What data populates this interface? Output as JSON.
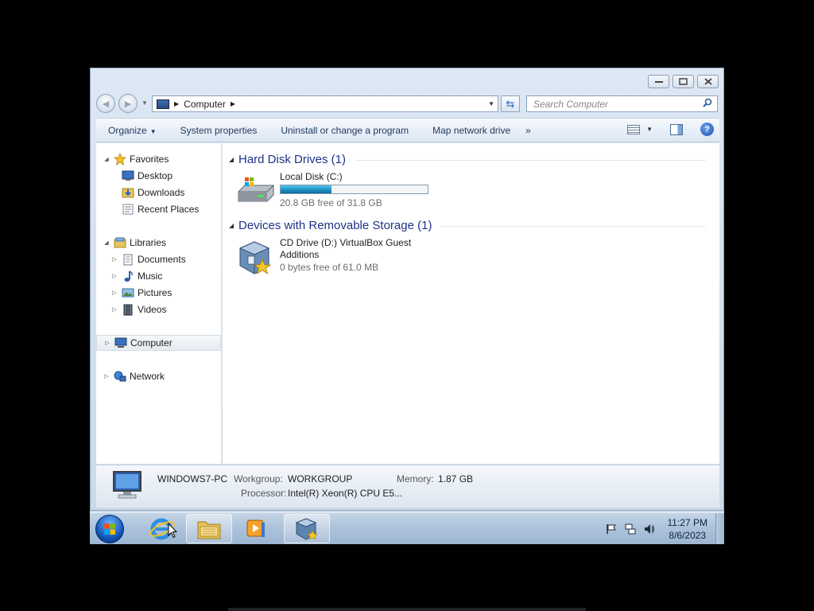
{
  "window": {
    "caption_buttons": [
      "minimize",
      "maximize",
      "close"
    ]
  },
  "address": {
    "crumb": "Computer",
    "search_placeholder": "Search Computer"
  },
  "toolbar": {
    "organize": "Organize",
    "system_properties": "System properties",
    "uninstall": "Uninstall or change a program",
    "map_drive": "Map network drive",
    "more": "»"
  },
  "nav": {
    "favorites": "Favorites",
    "desktop": "Desktop",
    "downloads": "Downloads",
    "recent": "Recent Places",
    "libraries": "Libraries",
    "documents": "Documents",
    "music": "Music",
    "pictures": "Pictures",
    "videos": "Videos",
    "computer": "Computer",
    "network": "Network"
  },
  "groups": {
    "hdd": {
      "title": "Hard Disk Drives (1)",
      "drive_name": "Local Disk (C:)",
      "free": "20.8 GB free of 31.8 GB",
      "used_fraction": 0.346
    },
    "removable": {
      "title": "Devices with Removable Storage (1)",
      "drive_name_line1": "CD Drive (D:) VirtualBox Guest",
      "drive_name_line2": "Additions",
      "free": "0 bytes free of 61.0 MB"
    }
  },
  "details": {
    "pc_name": "WINDOWS7-PC",
    "workgroup_label": "Workgroup:",
    "workgroup_value": "WORKGROUP",
    "memory_label": "Memory:",
    "memory_value": "1.87 GB",
    "processor_label": "Processor:",
    "processor_value": "Intel(R) Xeon(R) CPU E5..."
  },
  "taskbar": {
    "time": "11:27 PM",
    "date": "8/6/2023",
    "pinned": [
      "internet-explorer-icon",
      "windows-explorer-icon",
      "media-player-icon",
      "virtualbox-icon"
    ]
  },
  "colors": {
    "group_title": "#1e3287",
    "drive_bar": "#26a0d2",
    "desktop_bg": "#000000"
  }
}
